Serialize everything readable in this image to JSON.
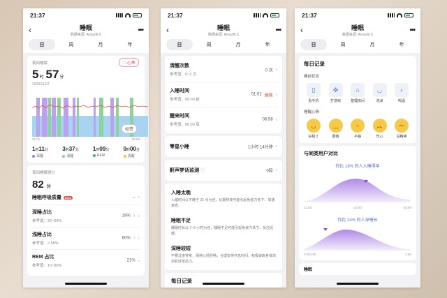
{
  "status": {
    "time": "21:37"
  },
  "nav": {
    "title": "睡眠",
    "source": "数据来源: Amazfit X",
    "more": "•••"
  },
  "tabs": [
    "日",
    "周",
    "月",
    "年"
  ],
  "colors": {
    "deep": "#9b7fe6",
    "light": "#7ec0ee",
    "rem": "#3cb371",
    "awake": "#f4c542",
    "heart": "#e74c3c"
  },
  "p1": {
    "night_label": "夜间睡眠",
    "total_h": "5",
    "h_unit": "时",
    "total_m": "57",
    "m_unit": "分",
    "date": "2020/11/27",
    "hr_button": "心率",
    "marker_button": "标签",
    "start_time": "01:01",
    "end_time": "06:58",
    "stats": [
      {
        "h": "1",
        "m": "11",
        "name": "深睡"
      },
      {
        "h": "3",
        "m": "37",
        "name": "浅睡"
      },
      {
        "h": "1",
        "m": "09",
        "name": "REM"
      },
      {
        "h": "0",
        "m": "00",
        "name": "清醒"
      }
    ],
    "score_label": "夜间睡眠得分",
    "score": "82",
    "score_unit": "分",
    "rows": [
      {
        "title": "睡眠呼吸质量",
        "badge": "Beta",
        "sub": "",
        "value": "--"
      },
      {
        "title": "深睡占比",
        "sub": "参考值：20~60%",
        "value": "19%",
        "arrow": "↓"
      },
      {
        "title": "浅睡占比",
        "sub": "参考值：< 55%",
        "value": "60%",
        "arrow": "↑"
      },
      {
        "title": "REM 占比",
        "sub": "参考值：10~30%",
        "value": "21%",
        "arrow": ""
      }
    ]
  },
  "p2": {
    "rows1": [
      {
        "title": "清醒次数",
        "sub": "参考值：0~2 次",
        "value": "0 次"
      },
      {
        "title": "入睡时间",
        "sub": "参考值：00:00 前",
        "value": "01:01",
        "warn": "偏晚"
      },
      {
        "title": "醒来时间",
        "sub": "参考值：06:00 后",
        "value": "06:58"
      }
    ],
    "nap": {
      "title": "零星小睡",
      "value": "1小时 14分钟"
    },
    "snore": {
      "title": "鼾声梦话监测",
      "value": "0段"
    },
    "advice": [
      {
        "title": "入睡太晚",
        "desc": "入睡时间以不晚于 22 点为佳，长期熬夜可能引起免疫力低下、加速衰老。"
      },
      {
        "title": "睡眠不足",
        "desc": "睡眠时长以 7~9 小时为佳，睡眠不足可能引起免疫力低下、反应迟缓。"
      },
      {
        "title": "深睡较短",
        "desc": "不要过度劳累，保持心情舒畅，合理安排作息时间，积极锻炼身体增加机体抵抗力。"
      }
    ],
    "daily": "每日记录"
  },
  "p3": {
    "daily": "每日记录",
    "state_label": "睡前状态",
    "states": [
      "看手机",
      "打游戏",
      "整理房间",
      "洗澡",
      "喝酒"
    ],
    "mood_label": "睡醒心情",
    "moods": [
      "好极了",
      "困倦",
      "平静",
      "伤心",
      "没精神"
    ],
    "compare_title": "与同类用户对比",
    "cmp1": "你比 18% 的人入睡得早",
    "cmp1_ticks": [
      "21:00",
      "01:00",
      "05:00"
    ],
    "cmp2": "你比 24% 的人深睡长",
    "cmp2_ticks": [
      "0.5h",
      "1.0h",
      "4.5h"
    ],
    "footer": "睡眠"
  }
}
